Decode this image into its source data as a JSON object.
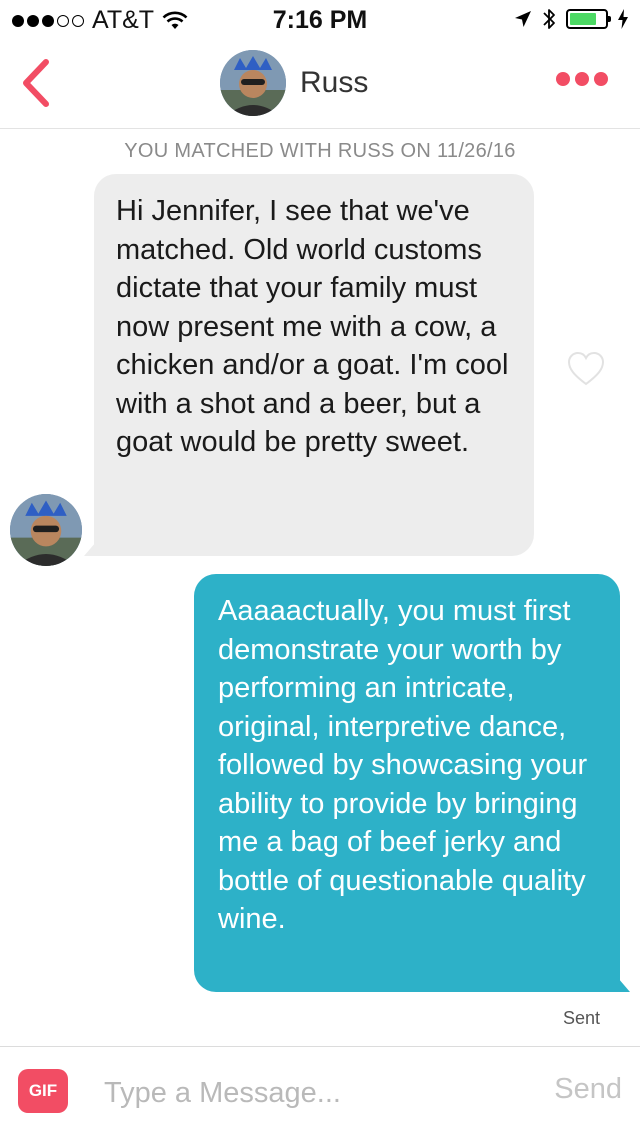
{
  "status_bar": {
    "carrier": "AT&T",
    "time": "7:16 PM",
    "signal_bars": 3,
    "signal_total": 5,
    "battery_level": 0.75,
    "battery_color": "#4cd964"
  },
  "header": {
    "back_icon": "chevron-left-icon",
    "contact_name": "Russ",
    "more_icon": "more-dots-icon",
    "accent_color": "#f24d64"
  },
  "conversation": {
    "match_notice": "YOU MATCHED WITH RUSS ON 11/26/16",
    "messages": [
      {
        "direction": "incoming",
        "sender": "Russ",
        "text": "Hi Jennifer, I see that we've matched. Old world customs dictate that your family must now present me with a cow, a chicken and/or a goat. I'm cool with a shot and a beer, but a goat would be pretty sweet."
      },
      {
        "direction": "outgoing",
        "text": "Aaaaactually, you must first demonstrate your worth by performing an intricate, original, interpretive dance, followed by showcasing your ability to provide by bringing me a bag of beef jerky and bottle of questionable quality wine.",
        "status": "Sent"
      }
    ],
    "outgoing_color": "#2db1c8"
  },
  "composer": {
    "gif_label": "GIF",
    "placeholder": "Type a Message...",
    "value": "",
    "send_label": "Send"
  }
}
